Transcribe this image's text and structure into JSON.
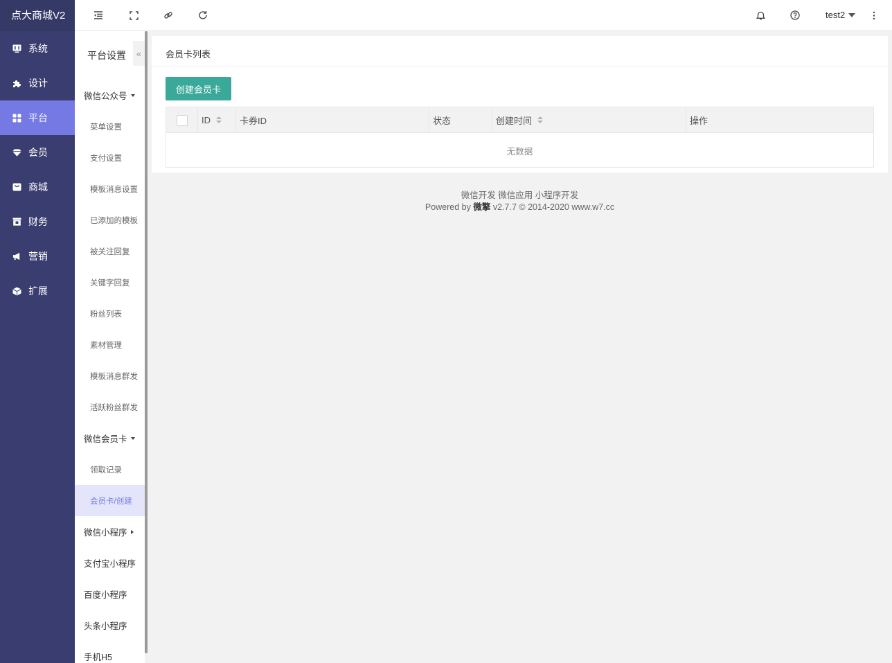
{
  "brand": "点大商城V2",
  "nav": [
    {
      "label": "系统",
      "icon": "monitor-icon"
    },
    {
      "label": "设计",
      "icon": "puzzle-icon"
    },
    {
      "label": "平台",
      "icon": "grid-icon",
      "active": true
    },
    {
      "label": "会员",
      "icon": "diamond-icon"
    },
    {
      "label": "商城",
      "icon": "shop-icon"
    },
    {
      "label": "财务",
      "icon": "finance-icon"
    },
    {
      "label": "营销",
      "icon": "megaphone-icon"
    },
    {
      "label": "扩展",
      "icon": "cube-icon"
    }
  ],
  "header": {
    "user": "test2"
  },
  "subnav": {
    "title": "平台设置",
    "collapse": "«",
    "items": [
      {
        "label": "微信公众号",
        "type": "group",
        "arrow": "down"
      },
      {
        "label": "菜单设置",
        "type": "child"
      },
      {
        "label": "支付设置",
        "type": "child"
      },
      {
        "label": "模板消息设置",
        "type": "child"
      },
      {
        "label": "已添加的模板",
        "type": "child"
      },
      {
        "label": "被关注回复",
        "type": "child"
      },
      {
        "label": "关键字回复",
        "type": "child"
      },
      {
        "label": "粉丝列表",
        "type": "child"
      },
      {
        "label": "素材管理",
        "type": "child"
      },
      {
        "label": "模板消息群发",
        "type": "child"
      },
      {
        "label": "活跃粉丝群发",
        "type": "child"
      },
      {
        "label": "微信会员卡",
        "type": "group",
        "arrow": "down"
      },
      {
        "label": "领取记录",
        "type": "child"
      },
      {
        "label": "会员卡/创建",
        "type": "child",
        "active": true
      },
      {
        "label": "微信小程序",
        "type": "group",
        "arrow": "right"
      },
      {
        "label": "支付宝小程序",
        "type": "group"
      },
      {
        "label": "百度小程序",
        "type": "group"
      },
      {
        "label": "头条小程序",
        "type": "group"
      },
      {
        "label": "手机H5",
        "type": "group"
      }
    ]
  },
  "main": {
    "card_title": "会员卡列表",
    "create_button": "创建会员卡",
    "table": {
      "columns": [
        "ID",
        "卡券ID",
        "状态",
        "创建时间",
        "操作"
      ],
      "empty": "无数据"
    }
  },
  "footer": {
    "links": "微信开发 微信应用 小程序开发",
    "powered_prefix": "Powered by",
    "powered_brand": "微擎",
    "powered_suffix": "v2.7.7 © 2014-2020 www.w7.cc"
  },
  "colors": {
    "sidebar": "#393d6f",
    "active_nav": "#7479e3",
    "primary_button": "#3aa99a",
    "active_sub_bg": "#e4e5fb"
  }
}
